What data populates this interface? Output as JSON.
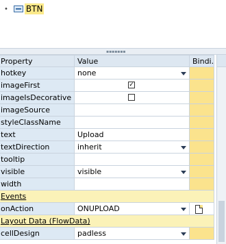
{
  "tree": {
    "node_label": "BTN"
  },
  "grid": {
    "headers": {
      "property": "Property",
      "value": "Value",
      "binding": "Bindi..."
    },
    "rows": [
      {
        "property": "hotkey",
        "value": "none"
      },
      {
        "property": "imageFirst",
        "value": ""
      },
      {
        "property": "imageIsDecorative",
        "value": ""
      },
      {
        "property": "imageSource",
        "value": ""
      },
      {
        "property": "styleClassName",
        "value": ""
      },
      {
        "property": "text",
        "value": "Upload"
      },
      {
        "property": "textDirection",
        "value": "inherit"
      },
      {
        "property": "tooltip",
        "value": ""
      },
      {
        "property": "visible",
        "value": "visible"
      },
      {
        "property": "width",
        "value": ""
      },
      {
        "property": "Events",
        "value": ""
      },
      {
        "property": "onAction",
        "value": "ONUPLOAD"
      },
      {
        "property": "Layout Data (FlowData)",
        "value": ""
      },
      {
        "property": "cellDesign",
        "value": "padless"
      }
    ],
    "checkboxes": {
      "imageFirst": true,
      "imageIsDecorative": false
    }
  }
}
